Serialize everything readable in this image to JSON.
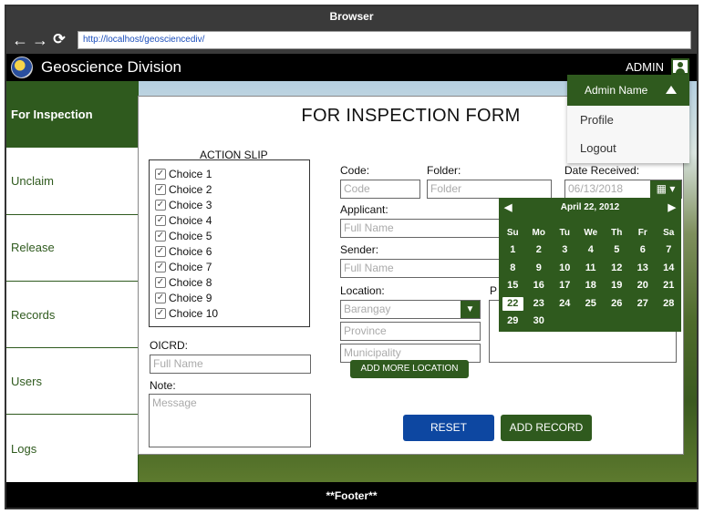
{
  "browser": {
    "title": "Browser",
    "url": "http://localhost/geosciencediv/"
  },
  "app": {
    "title": "Geoscience Division",
    "admin_label": "ADMIN"
  },
  "sidebar": {
    "items": [
      {
        "label": "For Inspection",
        "active": true
      },
      {
        "label": "Unclaim"
      },
      {
        "label": "Release"
      },
      {
        "label": "Records"
      },
      {
        "label": "Users"
      },
      {
        "label": "Logs"
      }
    ]
  },
  "form": {
    "title": "FOR INSPECTION FORM",
    "action_slip": {
      "label": "ACTION SLIP",
      "choices": [
        "Choice 1",
        "Choice 2",
        "Choice 3",
        "Choice 4",
        "Choice 5",
        "Choice 6",
        "Choice 7",
        "Choice 8",
        "Choice 9",
        "Choice 10"
      ],
      "checkmark": "✓"
    },
    "oicrd": {
      "label": "OICRD:",
      "placeholder": "Full Name"
    },
    "note": {
      "label": "Note:",
      "placeholder": "Message"
    },
    "code": {
      "label": "Code:",
      "placeholder": "Code"
    },
    "folder": {
      "label": "Folder:",
      "placeholder": "Folder"
    },
    "date_received": {
      "label": "Date Received:",
      "placeholder": "06/13/2018"
    },
    "applicant": {
      "label": "Applicant:",
      "placeholder": "Full Name"
    },
    "sender": {
      "label": "Sender:",
      "placeholder": "Full Name"
    },
    "location": {
      "label": "Location:",
      "barangay": "Barangay",
      "province": "Province",
      "municipality": "Municipality"
    },
    "partial_label": "P",
    "buttons": {
      "add_location": "ADD MORE LOCATION",
      "reset": "RESET",
      "add_record": "ADD RECORD"
    }
  },
  "calendar": {
    "month_label": "April 22, 2012",
    "prev": "◀",
    "next": "▶",
    "weekdays": [
      "Su",
      "Mo",
      "Tu",
      "We",
      "Th",
      "Fr",
      "Sa"
    ],
    "days": [
      1,
      2,
      3,
      4,
      5,
      6,
      7,
      8,
      9,
      10,
      11,
      12,
      13,
      14,
      15,
      16,
      17,
      18,
      19,
      20,
      21,
      22,
      23,
      24,
      25,
      26,
      27,
      28,
      29,
      30
    ],
    "selected_day": 22
  },
  "admin_menu": {
    "header": "Admin Name",
    "items": [
      "Profile",
      "Logout"
    ]
  },
  "footer": {
    "text": "**Footer**"
  },
  "colors": {
    "primary": "#2f5a1e",
    "reset": "#0d47a1"
  }
}
